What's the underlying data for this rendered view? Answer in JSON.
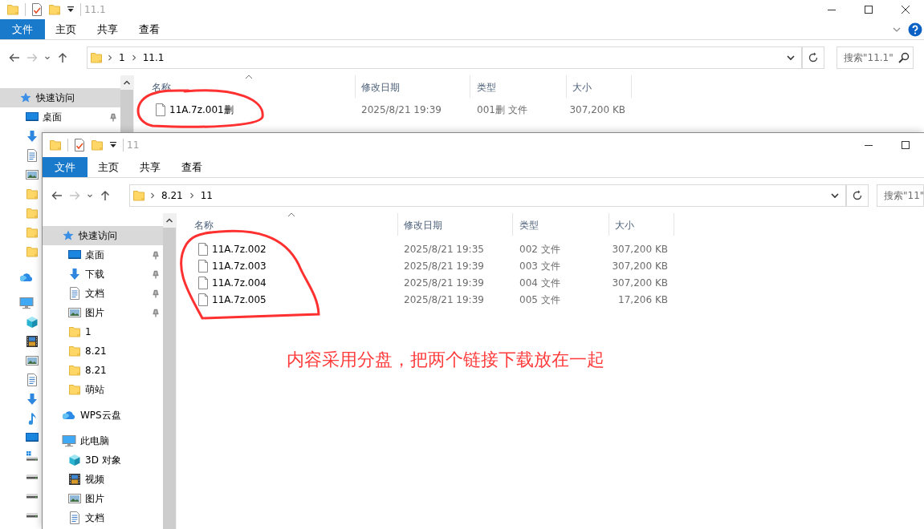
{
  "windows": [
    {
      "title": "11.1",
      "ribbon_tabs": [
        {
          "label": "文件",
          "selected": true
        },
        {
          "label": "主页",
          "selected": false
        },
        {
          "label": "共享",
          "selected": false
        },
        {
          "label": "查看",
          "selected": false
        }
      ],
      "breadcrumb": [
        "1",
        "11.1"
      ],
      "search": {
        "placeholder": "搜索\"11.1\""
      },
      "columns": [
        "名称",
        "修改日期",
        "类型",
        "大小"
      ],
      "sidebar": [
        {
          "kind": "star",
          "label": "快速访问",
          "selected": true,
          "children": [
            {
              "kind": "desktop",
              "label": "桌面",
              "selected": false,
              "pinned": true
            },
            {
              "kind": "download",
              "selected": false
            },
            {
              "kind": "document",
              "selected": false
            },
            {
              "kind": "picture",
              "selected": false
            },
            {
              "kind": "folder",
              "selected": false
            },
            {
              "kind": "folder",
              "selected": false
            },
            {
              "kind": "folder",
              "selected": false
            },
            {
              "kind": "folder",
              "selected": false
            }
          ]
        },
        {
          "kind": "cloud",
          "selected": false
        },
        {
          "kind": "pc",
          "selected": false,
          "children": [
            {
              "kind": "cube",
              "selected": false
            },
            {
              "kind": "film",
              "selected": false
            },
            {
              "kind": "picture",
              "selected": false
            },
            {
              "kind": "document",
              "selected": false
            },
            {
              "kind": "download",
              "selected": false
            },
            {
              "kind": "music",
              "selected": false
            },
            {
              "kind": "desktop",
              "selected": false
            },
            {
              "kind": "netdrive",
              "selected": false
            },
            {
              "kind": "drive",
              "selected": false
            },
            {
              "kind": "drive",
              "selected": false
            },
            {
              "kind": "drive",
              "selected": false
            }
          ]
        }
      ],
      "files": [
        {
          "name": "11A.7z.001删",
          "modified": "2025/8/21 19:39",
          "type": "001删 文件",
          "size": "307,200 KB"
        }
      ]
    },
    {
      "title": "11",
      "ribbon_tabs": [
        {
          "label": "文件",
          "selected": true
        },
        {
          "label": "主页",
          "selected": false
        },
        {
          "label": "共享",
          "selected": false
        },
        {
          "label": "查看",
          "selected": false
        }
      ],
      "breadcrumb": [
        "8.21",
        "11"
      ],
      "search": {
        "placeholder": "搜索\"11\""
      },
      "columns": [
        "名称",
        "修改日期",
        "类型",
        "大小"
      ],
      "sidebar": [
        {
          "kind": "star",
          "label": "快速访问",
          "selected": true,
          "pinned": false,
          "children": [
            {
              "kind": "desktop",
              "label": "桌面",
              "selected": false,
              "pinned": true
            },
            {
              "kind": "download",
              "label": "下载",
              "selected": false,
              "pinned": true
            },
            {
              "kind": "document",
              "label": "文档",
              "selected": false,
              "pinned": true
            },
            {
              "kind": "picture",
              "label": "图片",
              "selected": false,
              "pinned": true
            },
            {
              "kind": "folder",
              "label": "1",
              "selected": false,
              "pinned": false
            },
            {
              "kind": "folder",
              "label": "8.21",
              "selected": false,
              "pinned": false
            },
            {
              "kind": "folder",
              "label": "8.21",
              "selected": false,
              "pinned": false
            },
            {
              "kind": "folder",
              "label": "萌站",
              "selected": false,
              "pinned": false
            }
          ]
        },
        {
          "kind": "cloud",
          "label": "WPS云盘",
          "selected": false,
          "pinned": false
        },
        {
          "kind": "pc",
          "label": "此电脑",
          "selected": false,
          "pinned": false,
          "children": [
            {
              "kind": "cube",
              "label": "3D 对象",
              "selected": false,
              "pinned": false
            },
            {
              "kind": "film",
              "label": "视频",
              "selected": false,
              "pinned": false
            },
            {
              "kind": "picture",
              "label": "图片",
              "selected": false,
              "pinned": false
            },
            {
              "kind": "document",
              "label": "文档",
              "selected": false,
              "pinned": false
            }
          ]
        }
      ],
      "files": [
        {
          "name": "11A.7z.002",
          "modified": "2025/8/21 19:35",
          "type": "002 文件",
          "size": "307,200 KB"
        },
        {
          "name": "11A.7z.003",
          "modified": "2025/8/21 19:39",
          "type": "003 文件",
          "size": "307,200 KB"
        },
        {
          "name": "11A.7z.004",
          "modified": "2025/8/21 19:39",
          "type": "004 文件",
          "size": "307,200 KB"
        },
        {
          "name": "11A.7z.005",
          "modified": "2025/8/21 19:39",
          "type": "005 文件",
          "size": "17,206 KB"
        }
      ]
    }
  ],
  "annotation": {
    "text": "内容采用分盘，把两个链接下载放在一起"
  }
}
